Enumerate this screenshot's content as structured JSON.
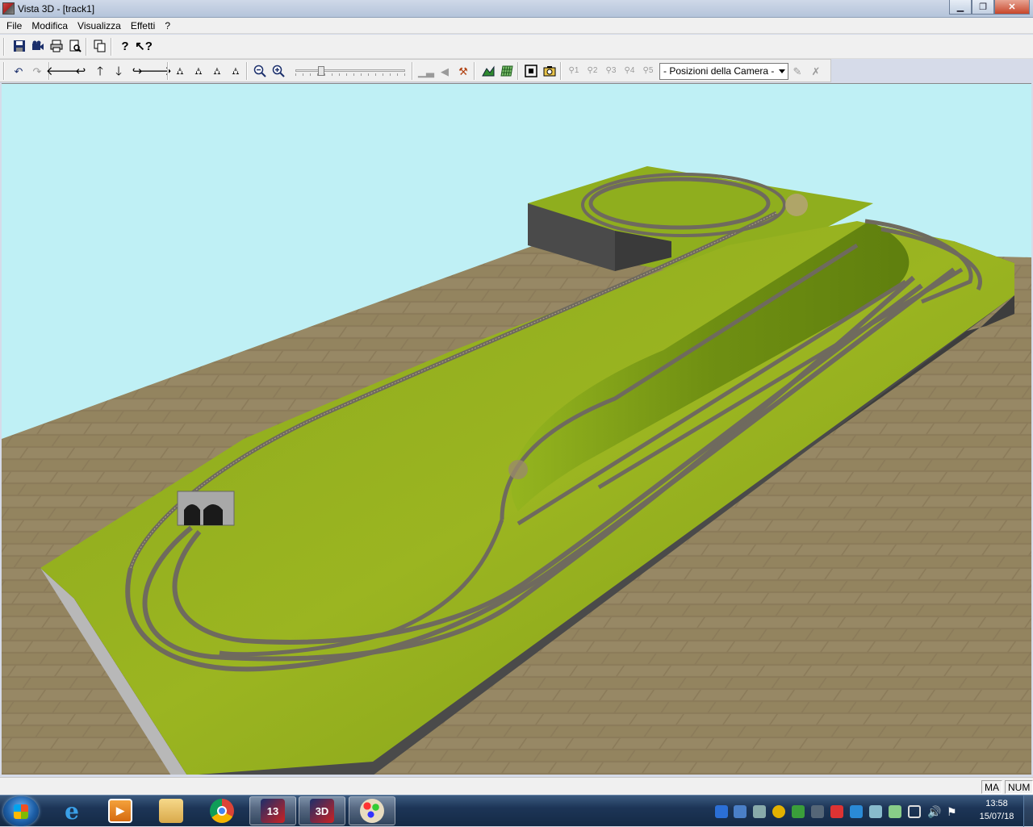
{
  "window": {
    "title": "Vista 3D - [track1]"
  },
  "menu": {
    "items": [
      "File",
      "Modifica",
      "Visualizza",
      "Effetti",
      "?"
    ]
  },
  "toolbar": {
    "camera_positions": "- Posizioni della Camera -",
    "zoom_level": 0.22
  },
  "statusbar": {
    "caps": "MA",
    "num": "NUM"
  },
  "taskbar": {
    "time": "13:58",
    "date": "15/07/18",
    "apps": [
      "internet-explorer-icon",
      "media-player-icon",
      "file-explorer-icon",
      "chrome-icon",
      "track-planner-icon",
      "vista-3d-icon",
      "paint-icon"
    ],
    "track_badge": "13",
    "vista_badge": "3D"
  }
}
